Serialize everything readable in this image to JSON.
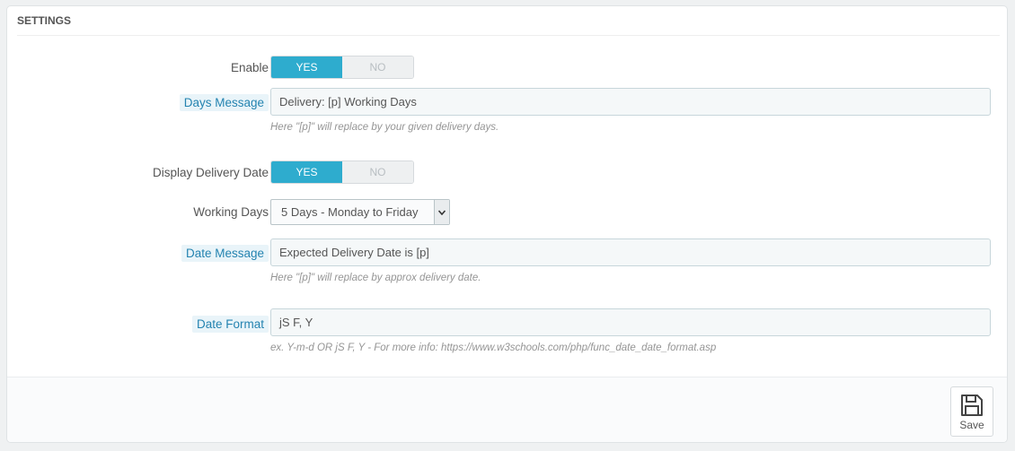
{
  "panel": {
    "title": "SETTINGS"
  },
  "enable": {
    "label": "Enable",
    "yes": "YES",
    "no": "NO",
    "value": "YES"
  },
  "days_message": {
    "label": "Days Message",
    "value": "Delivery: [p] Working Days",
    "help": "Here \"[p]\" will replace by your given delivery days."
  },
  "display_delivery_date": {
    "label": "Display Delivery Date",
    "yes": "YES",
    "no": "NO",
    "value": "YES"
  },
  "working_days": {
    "label": "Working Days",
    "selected": "5 Days - Monday to Friday"
  },
  "date_message": {
    "label": "Date Message",
    "value": "Expected Delivery Date is [p]",
    "help": "Here \"[p]\" will replace by approx delivery date."
  },
  "date_format": {
    "label": "Date Format",
    "value": "jS F, Y",
    "help": "ex. Y-m-d OR jS F, Y - For more info: https://www.w3schools.com/php/func_date_date_format.asp"
  },
  "footer": {
    "save_label": "Save",
    "save_icon": "floppy-disk-icon"
  },
  "colors": {
    "accent": "#2eacce",
    "hint_label": "#2483b0"
  }
}
